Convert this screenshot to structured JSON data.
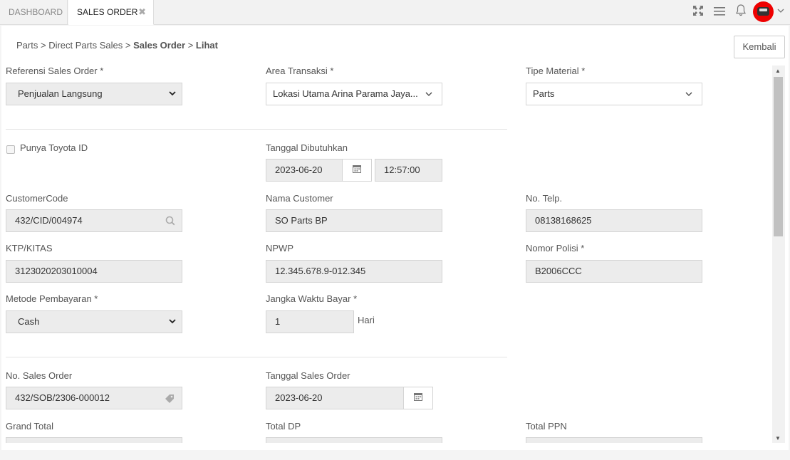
{
  "tabs": [
    {
      "label": "DASHBOARD"
    },
    {
      "label": "SALES ORDER",
      "close": "✖"
    }
  ],
  "breadcrumb": {
    "parts": "Parts",
    "direct": "Direct Parts Sales",
    "so": "Sales Order",
    "view": "Lihat",
    "sep": ">"
  },
  "header": {
    "back_label": "Kembali"
  },
  "form": {
    "referensi_label": "Referensi Sales Order *",
    "referensi_value": "Penjualan Langsung",
    "area_label": "Area Transaksi *",
    "area_value": "Lokasi Utama Arina Parama Jaya...",
    "tipe_label": "Tipe Material *",
    "tipe_value": "Parts",
    "toyota_id_label": "Punya Toyota ID",
    "tanggal_dibutuhkan_label": "Tanggal Dibutuhkan",
    "tanggal_dibutuhkan_date": "2023-06-20",
    "tanggal_dibutuhkan_time": "12:57:00",
    "customer_code_label": "CustomerCode",
    "customer_code_value": "432/CID/004974",
    "nama_customer_label": "Nama Customer",
    "nama_customer_value": "SO Parts BP",
    "telp_label": "No. Telp.",
    "telp_value": "08138168625",
    "ktp_label": "KTP/KITAS",
    "ktp_value": "3123020203010004",
    "npwp_label": "NPWP",
    "npwp_value": "12.345.678.9-012.345",
    "polisi_label": "Nomor Polisi *",
    "polisi_value": "B2006CCC",
    "metode_label": "Metode Pembayaran *",
    "metode_value": "Cash",
    "jangka_label": "Jangka Waktu Bayar *",
    "jangka_value": "1",
    "jangka_suffix": "Hari",
    "no_so_label": "No. Sales Order",
    "no_so_value": "432/SOB/2306-000012",
    "tanggal_so_label": "Tanggal Sales Order",
    "tanggal_so_value": "2023-06-20",
    "grand_total_label": "Grand Total",
    "total_dp_label": "Total DP",
    "total_ppn_label": "Total PPN"
  },
  "icons": {
    "expand": "expand-icon",
    "menu": "hamburger-menu-icon",
    "bell": "bell-icon",
    "avatar": "avatar-car-icon",
    "caret": "chevron-down-icon",
    "calendar": "calendar-icon",
    "search": "search-icon",
    "tag": "tag-icon"
  }
}
